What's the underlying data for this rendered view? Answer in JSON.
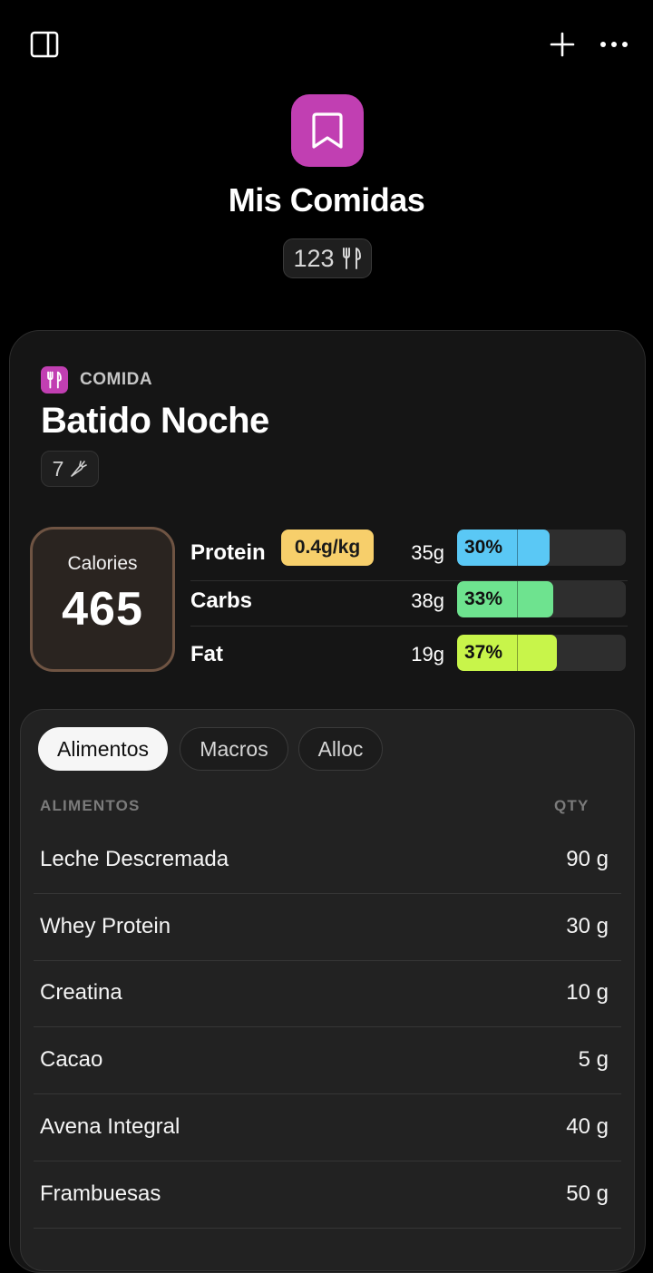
{
  "toolbar": {
    "sidebar_icon": "sidebar-toggle-icon",
    "add_icon": "plus-icon",
    "more_icon": "ellipsis-icon"
  },
  "header": {
    "icon": "bookmark-icon",
    "icon_color": "#c13fb2",
    "title": "Mis Comidas",
    "count": "123",
    "count_icon": "fork-knife-icon"
  },
  "meal": {
    "type_label": "COMIDA",
    "type_icon": "fork-knife-icon",
    "name": "Batido Noche",
    "ingredient_count": "7",
    "ingredient_icon": "carrot-icon",
    "calories_label": "Calories",
    "calories_value": "465"
  },
  "macros": [
    {
      "name": "Protein",
      "badge": "0.4g/kg",
      "grams": "35g",
      "percent_label": "30%",
      "percent": 30,
      "color": "#5ac8f5"
    },
    {
      "name": "Carbs",
      "badge": "",
      "grams": "38g",
      "percent_label": "33%",
      "percent": 33,
      "color": "#6ee38f"
    },
    {
      "name": "Fat",
      "badge": "",
      "grams": "19g",
      "percent_label": "37%",
      "percent": 37,
      "color": "#c8f54a"
    }
  ],
  "tabs": [
    {
      "label": "Alimentos",
      "active": true
    },
    {
      "label": "Macros",
      "active": false
    },
    {
      "label": "Alloc",
      "active": false
    }
  ],
  "table": {
    "col_food": "ALIMENTOS",
    "col_qty": "QTY",
    "rows": [
      {
        "name": "Leche Descremada",
        "qty": "90 g"
      },
      {
        "name": "Whey Protein",
        "qty": "30 g"
      },
      {
        "name": "Creatina",
        "qty": "10 g"
      },
      {
        "name": "Cacao",
        "qty": "5 g"
      },
      {
        "name": "Avena Integral",
        "qty": "40 g"
      },
      {
        "name": "Frambuesas",
        "qty": "50 g"
      }
    ]
  }
}
